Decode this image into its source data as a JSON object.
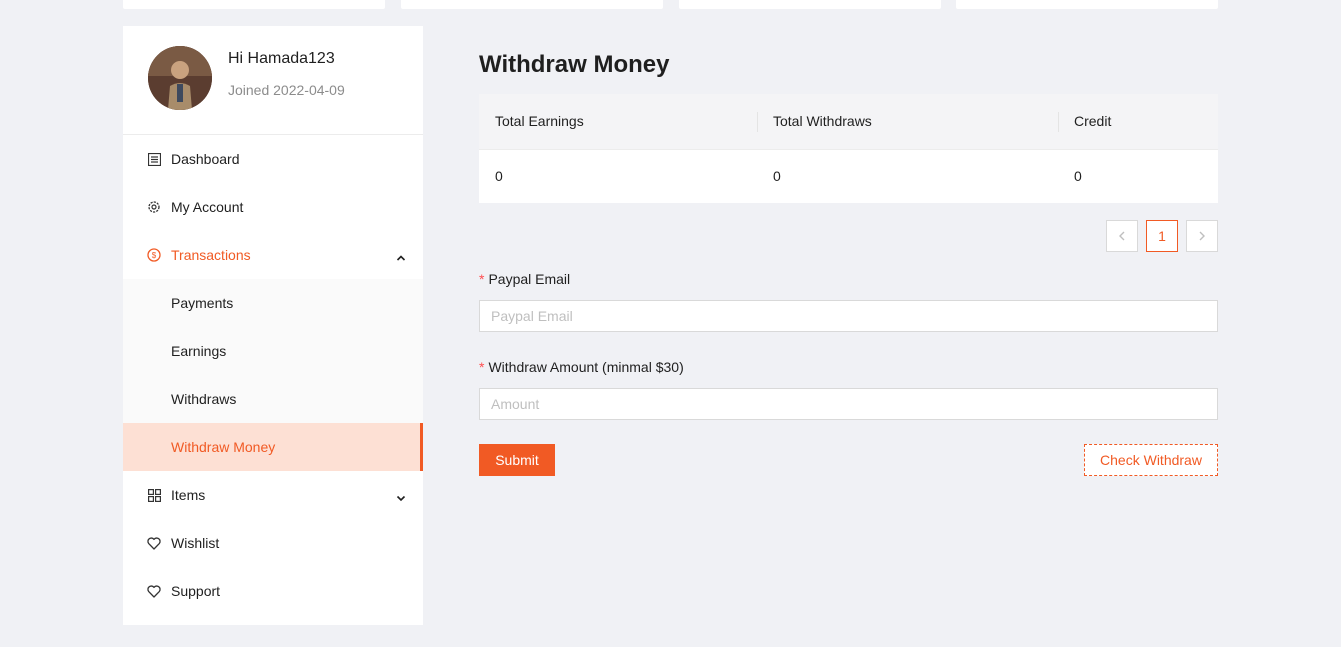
{
  "user": {
    "greeting": "Hi Hamada123",
    "joined": "Joined 2022-04-09"
  },
  "sidebar": {
    "items": [
      {
        "label": "Dashboard",
        "icon": "list-icon"
      },
      {
        "label": "My Account",
        "icon": "gear-icon"
      },
      {
        "label": "Transactions",
        "icon": "dollar-circle-icon",
        "expanded": true
      },
      {
        "label": "Items",
        "icon": "grid-icon",
        "expanded": false
      },
      {
        "label": "Wishlist",
        "icon": "heart-icon"
      },
      {
        "label": "Support",
        "icon": "heart-icon"
      }
    ],
    "transactions_sub": [
      {
        "label": "Payments"
      },
      {
        "label": "Earnings"
      },
      {
        "label": "Withdraws"
      },
      {
        "label": "Withdraw Money",
        "selected": true
      }
    ]
  },
  "main": {
    "title": "Withdraw Money",
    "table": {
      "headers": [
        "Total Earnings",
        "Total Withdraws",
        "Credit"
      ],
      "row": [
        "0",
        "0",
        "0"
      ]
    },
    "pagination": {
      "current": "1"
    },
    "form": {
      "email_label": "Paypal Email",
      "email_placeholder": "Paypal Email",
      "amount_label": "Withdraw Amount (minmal $30)",
      "amount_placeholder": "Amount",
      "submit_label": "Submit",
      "check_label": "Check Withdraw"
    }
  },
  "colors": {
    "accent": "#f15a24",
    "background": "#f0f1f5"
  }
}
